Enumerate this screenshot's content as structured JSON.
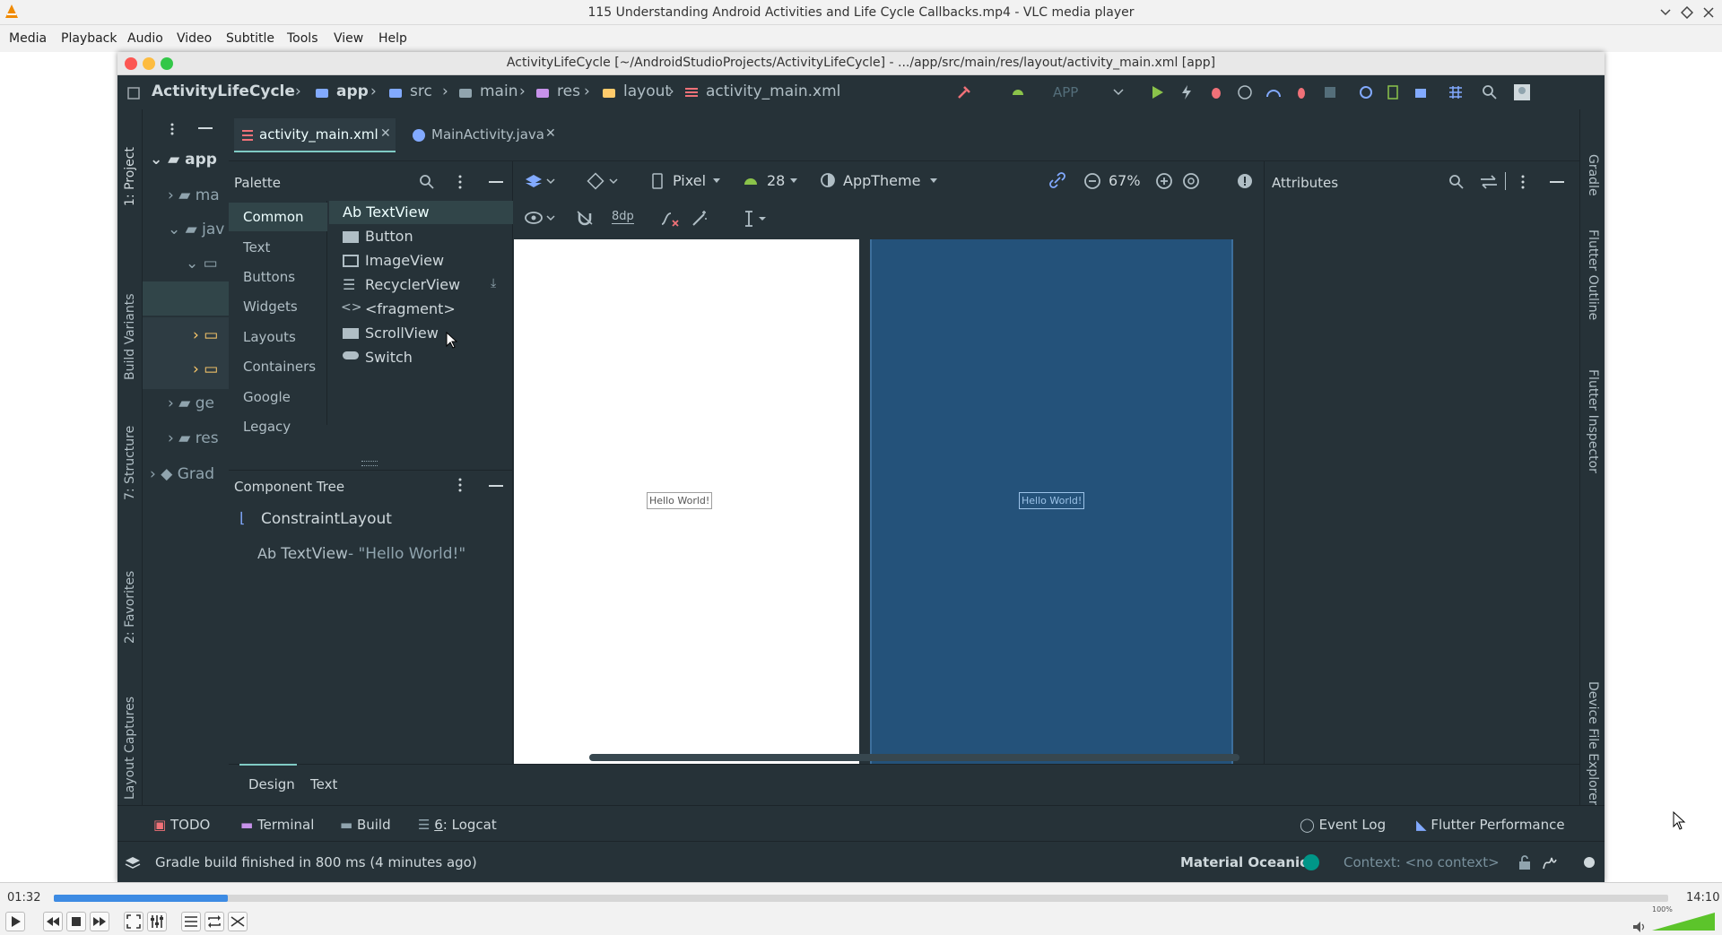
{
  "vlc": {
    "window_title": "115 Understanding Android Activities and Life Cycle Callbacks.mp4 - VLC media player",
    "menu": [
      "Media",
      "Playback",
      "Audio",
      "Video",
      "Subtitle",
      "Tools",
      "View",
      "Help"
    ],
    "time_elapsed": "01:32",
    "time_total": "14:10",
    "progress_fraction": 0.108,
    "volume_percent": "100%",
    "volume_fraction": 1.0
  },
  "ide": {
    "window_title": "ActivityLifeCycle [~/AndroidStudioProjects/ActivityLifeCycle] - .../app/src/main/res/layout/activity_main.xml [app]",
    "breadcrumb": [
      "ActivityLifeCycle",
      "app",
      "src",
      "main",
      "res",
      "layout",
      "activity_main.xml"
    ],
    "run_config": "APP",
    "left_stripe": [
      "1: Project",
      "Build Variants",
      "7: Structure",
      "2: Favorites",
      "Layout Captures"
    ],
    "right_stripe": [
      "Gradle",
      "Flutter Outline",
      "Flutter Inspector",
      "Device File Explorer"
    ],
    "project_tree": [
      "app",
      "ma",
      "jav",
      "ge",
      "res",
      "Grad"
    ],
    "tabs": [
      {
        "label": "activity_main.xml",
        "active": true
      },
      {
        "label": "MainActivity.java",
        "active": false
      }
    ],
    "palette": {
      "title": "Palette",
      "categories": [
        "Common",
        "Text",
        "Buttons",
        "Widgets",
        "Layouts",
        "Containers",
        "Google",
        "Legacy"
      ],
      "items": [
        "TextView",
        "Button",
        "ImageView",
        "RecyclerView",
        "<fragment>",
        "ScrollView",
        "Switch"
      ],
      "textview_prefix": "Ab"
    },
    "toolbar": {
      "device": "Pixel",
      "api": "28",
      "theme": "AppTheme",
      "zoom": "67%",
      "margin": "8dp"
    },
    "design_preview_text": "Hello World!",
    "blueprint_preview_text": "Hello World!",
    "attributes_title": "Attributes",
    "component_tree": {
      "title": "Component Tree",
      "root": "ConstraintLayout",
      "child_prefix": "Ab",
      "child": "TextView",
      "child_text": "- \"Hello World!\""
    },
    "design_tabs": [
      "Design",
      "Text"
    ],
    "tool_windows": [
      {
        "num": "",
        "label": "TODO"
      },
      {
        "num": "",
        "label": "Terminal"
      },
      {
        "num": "",
        "label": "Build"
      },
      {
        "num": "6",
        "label": ": Logcat"
      }
    ],
    "right_tools": [
      "Event Log",
      "Flutter Performance"
    ],
    "status_message": "Gradle build finished in 800 ms (4 minutes ago)",
    "theme_name": "Material Oceanic",
    "context": "Context: <no context>"
  },
  "colors": {
    "ide_bg": "#263238",
    "accent": "#80cbc4",
    "blueprint": "#24527a",
    "text": "#b0bec5"
  }
}
